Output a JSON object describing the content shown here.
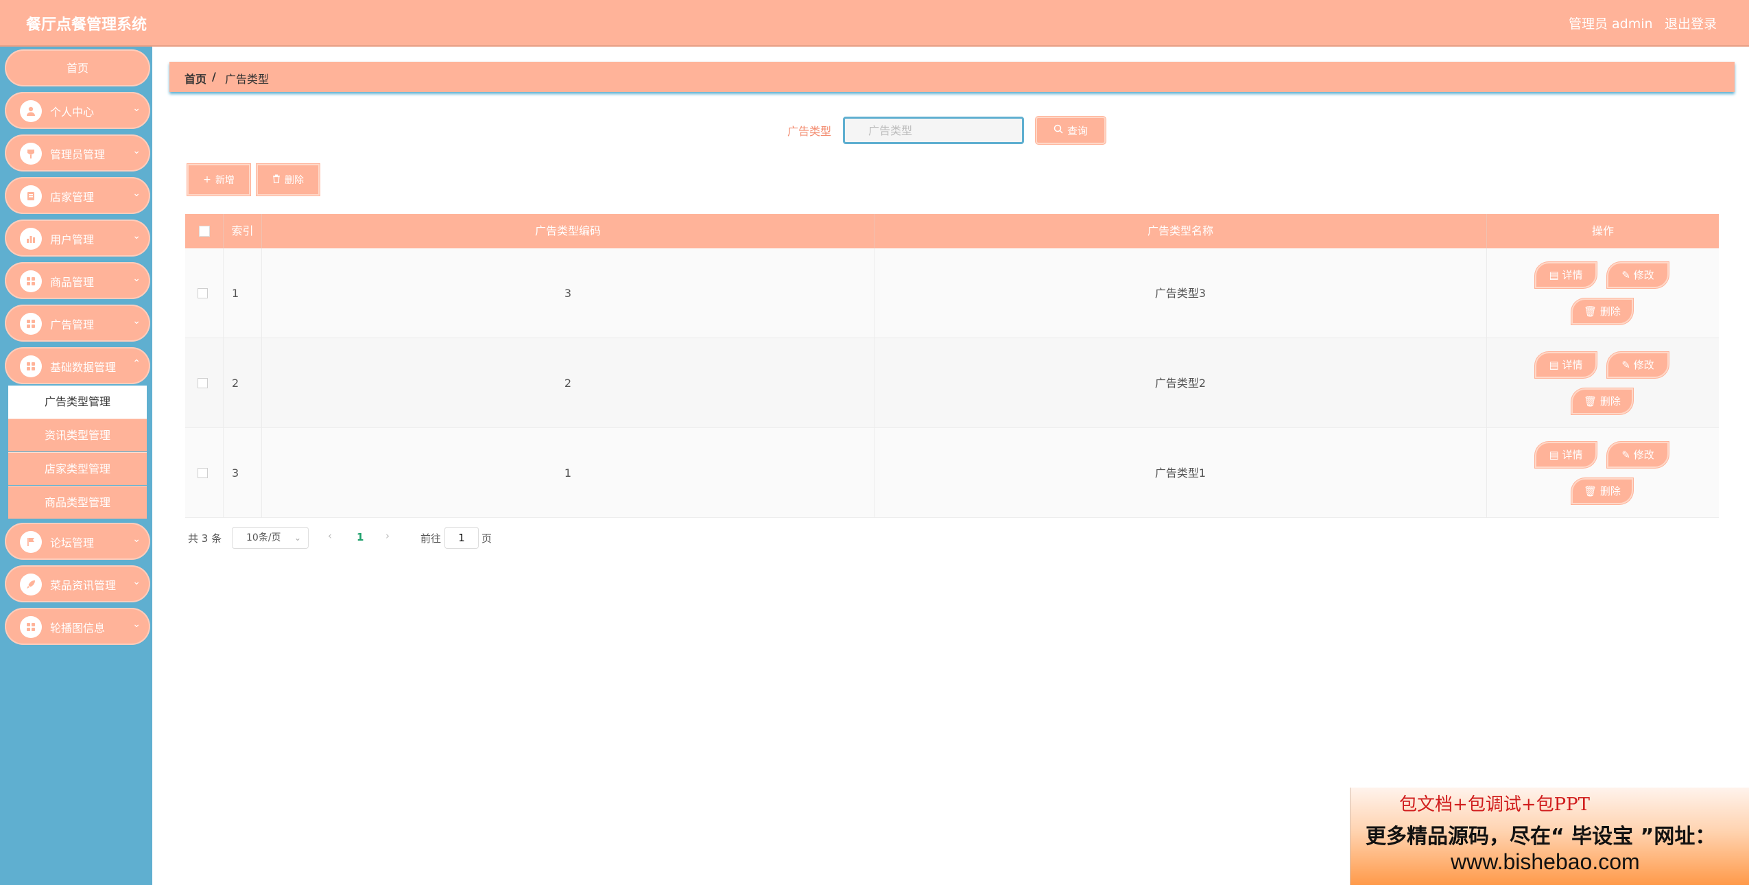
{
  "header": {
    "title": "餐厅点餐管理系统",
    "user": "管理员 admin",
    "logout": "退出登录"
  },
  "sidebar": {
    "home": "首页",
    "items": [
      {
        "label": "个人中心",
        "icon": "user-icon"
      },
      {
        "label": "管理员管理",
        "icon": "admin-icon"
      },
      {
        "label": "店家管理",
        "icon": "shop-icon"
      },
      {
        "label": "用户管理",
        "icon": "chart-icon"
      },
      {
        "label": "商品管理",
        "icon": "grid-icon"
      },
      {
        "label": "广告管理",
        "icon": "grid-icon"
      },
      {
        "label": "基础数据管理",
        "icon": "grid-icon"
      },
      {
        "label": "论坛管理",
        "icon": "flag-icon"
      },
      {
        "label": "菜品资讯管理",
        "icon": "rocket-icon"
      },
      {
        "label": "轮播图信息",
        "icon": "grid-icon"
      }
    ],
    "submenu": [
      "广告类型管理",
      "资讯类型管理",
      "店家类型管理",
      "商品类型管理"
    ]
  },
  "breadcrumb": {
    "home": "首页",
    "sep": "/",
    "current": "广告类型"
  },
  "search": {
    "label": "广告类型",
    "placeholder": "广告类型",
    "button": "查询"
  },
  "actions": {
    "add": "新增",
    "delete": "删除"
  },
  "table": {
    "headers": [
      "索引",
      "广告类型编码",
      "广告类型名称",
      "操作"
    ],
    "rows": [
      {
        "index": "1",
        "code": "3",
        "name": "广告类型3"
      },
      {
        "index": "2",
        "code": "2",
        "name": "广告类型2"
      },
      {
        "index": "3",
        "code": "1",
        "name": "广告类型1"
      }
    ],
    "ops": {
      "detail": "详情",
      "edit": "修改",
      "delete": "删除"
    }
  },
  "pagination": {
    "total": "共 3 条",
    "page_size": "10条/页",
    "current_page": "1",
    "goto_label": "前往",
    "goto_value": "1",
    "goto_unit": "页"
  },
  "banner": {
    "line1": "包文档+包调试+包PPT",
    "line2": "更多精品源码，尽在“ 毕设宝 ”网址：",
    "line3": "www.bishebao.com"
  },
  "colors": {
    "primary": "#ffb399",
    "sidebar": "#5fafd0",
    "accent_text": "#f38d71",
    "active_page": "#1ea06b"
  }
}
